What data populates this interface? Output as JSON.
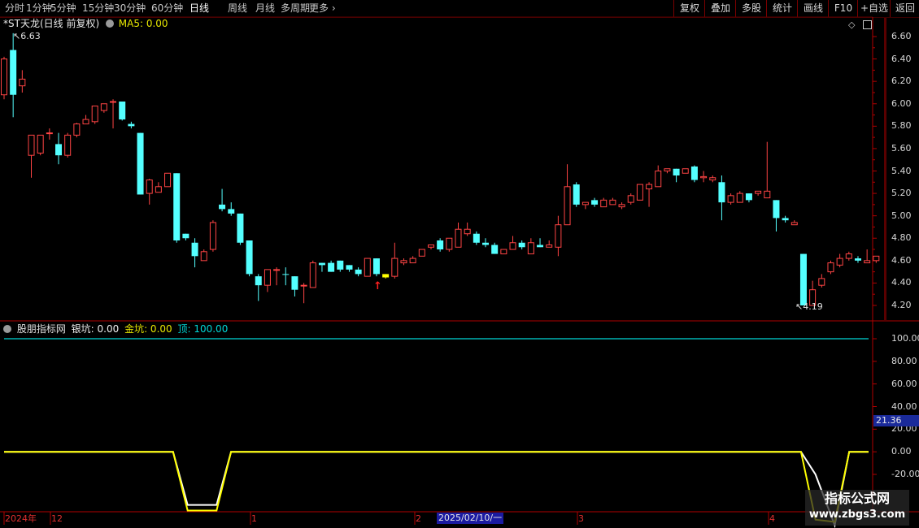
{
  "toolbar": {
    "periods": [
      "分时",
      "1分钟",
      "5分钟",
      "15分钟",
      "30分钟",
      "60分钟",
      "日线",
      "周线",
      "月线",
      "多周期",
      "更多"
    ],
    "active_period": "日线",
    "right_buttons": [
      "复权",
      "叠加",
      "多股",
      "统计",
      "画线",
      "F10",
      "+自选",
      "返回"
    ]
  },
  "main_panel": {
    "title": "*ST天龙(日线 前复权)",
    "indicator": "MA5: 0.00",
    "high_label": "6.63",
    "low_label": "4.19",
    "y_axis_labels": [
      "6.60",
      "6.40",
      "6.20",
      "6.00",
      "5.80",
      "5.60",
      "5.40",
      "5.20",
      "5.00",
      "4.80",
      "4.60",
      "4.40",
      "4.20"
    ]
  },
  "sub_panel": {
    "title": "股朋指标网",
    "silver_label": "银坑: 0.00",
    "gold_label": "金坑: 0.00",
    "top_label": "顶: 100.00",
    "y_axis_labels": [
      "100.00",
      "80.00",
      "60.00",
      "40.00",
      "20.00",
      "0.00",
      "-20.00"
    ],
    "cursor_value": "21.36"
  },
  "x_axis": {
    "labels": [
      "2024年",
      "12",
      "1",
      "2",
      "3",
      "4"
    ],
    "cursor_date": "2025/02/10/一"
  },
  "watermark": {
    "title": "指标公式网",
    "url": "www.zbgs3.com"
  },
  "colors": {
    "up": "#ff4444",
    "down": "#54ffff",
    "highlight": "#ffff00",
    "axis": "#b00000",
    "top_line": "#00d7d7",
    "gold_line": "#ffff00",
    "silver_line": "#ffffff"
  },
  "chart_data": [
    {
      "type": "candlestick",
      "title": "*ST天龙(日线 前复权)",
      "ylim": [
        4.15,
        6.7
      ],
      "columns": [
        "open",
        "close",
        "high",
        "low",
        "direction"
      ],
      "candles": [
        [
          6.4,
          6.08,
          6.42,
          6.04,
          "up"
        ],
        [
          6.48,
          6.08,
          6.63,
          5.88,
          "down"
        ],
        [
          6.16,
          6.22,
          6.3,
          6.1,
          "up"
        ],
        [
          5.54,
          5.72,
          5.72,
          5.34,
          "up"
        ],
        [
          5.56,
          5.72,
          5.72,
          5.54,
          "up"
        ],
        [
          5.74,
          5.74,
          5.78,
          5.68,
          "up"
        ],
        [
          5.64,
          5.54,
          5.74,
          5.46,
          "down"
        ],
        [
          5.72,
          5.54,
          5.74,
          5.52,
          "up"
        ],
        [
          5.72,
          5.82,
          5.83,
          5.7,
          "up"
        ],
        [
          5.86,
          5.82,
          5.9,
          5.82,
          "up"
        ],
        [
          5.84,
          5.98,
          5.98,
          5.82,
          "up"
        ],
        [
          5.94,
          6.0,
          6.0,
          5.92,
          "up"
        ],
        [
          6.02,
          6.02,
          6.04,
          5.78,
          "up"
        ],
        [
          6.02,
          5.86,
          6.02,
          5.85,
          "down"
        ],
        [
          5.82,
          5.8,
          5.84,
          5.78,
          "down"
        ],
        [
          5.74,
          5.19,
          5.74,
          5.19,
          "down"
        ],
        [
          5.2,
          5.32,
          5.33,
          5.1,
          "up"
        ],
        [
          5.21,
          5.26,
          5.3,
          5.21,
          "up"
        ],
        [
          5.38,
          5.26,
          5.38,
          5.26,
          "up"
        ],
        [
          5.38,
          4.78,
          5.38,
          4.76,
          "down"
        ],
        [
          4.84,
          4.8,
          4.84,
          4.78,
          "down"
        ],
        [
          4.76,
          4.64,
          4.8,
          4.54,
          "down"
        ],
        [
          4.6,
          4.68,
          4.7,
          4.6,
          "up"
        ],
        [
          4.7,
          4.94,
          4.96,
          4.68,
          "up"
        ],
        [
          5.1,
          5.06,
          5.24,
          5.04,
          "down"
        ],
        [
          5.06,
          5.02,
          5.12,
          5.0,
          "down"
        ],
        [
          5.02,
          4.76,
          5.02,
          4.74,
          "down"
        ],
        [
          4.78,
          4.48,
          4.78,
          4.46,
          "down"
        ],
        [
          4.46,
          4.38,
          4.48,
          4.24,
          "down"
        ],
        [
          4.38,
          4.52,
          4.52,
          4.32,
          "up"
        ],
        [
          4.52,
          4.52,
          4.54,
          4.38,
          "up"
        ],
        [
          4.48,
          4.48,
          4.54,
          4.38,
          "down"
        ],
        [
          4.46,
          4.34,
          4.46,
          4.28,
          "down"
        ],
        [
          4.38,
          4.38,
          4.4,
          4.22,
          "up"
        ],
        [
          4.36,
          4.58,
          4.6,
          4.36,
          "up"
        ],
        [
          4.58,
          4.56,
          4.58,
          4.5,
          "down"
        ],
        [
          4.58,
          4.5,
          4.6,
          4.5,
          "down"
        ],
        [
          4.6,
          4.52,
          4.6,
          4.5,
          "down"
        ],
        [
          4.56,
          4.52,
          4.56,
          4.5,
          "down"
        ],
        [
          4.52,
          4.48,
          4.54,
          4.46,
          "down"
        ],
        [
          4.46,
          4.62,
          4.62,
          4.46,
          "up"
        ],
        [
          4.62,
          4.48,
          4.62,
          4.46,
          "down"
        ],
        [
          4.48,
          4.45,
          4.48,
          4.44,
          "up"
        ],
        [
          4.46,
          4.62,
          4.76,
          4.44,
          "up"
        ],
        [
          4.58,
          4.6,
          4.62,
          4.56,
          "up"
        ],
        [
          4.58,
          4.62,
          4.64,
          4.58,
          "up"
        ],
        [
          4.64,
          4.7,
          4.7,
          4.64,
          "up"
        ],
        [
          4.72,
          4.74,
          4.74,
          4.7,
          "up"
        ],
        [
          4.78,
          4.7,
          4.8,
          4.68,
          "down"
        ],
        [
          4.7,
          4.8,
          4.8,
          4.68,
          "up"
        ],
        [
          4.72,
          4.88,
          4.94,
          4.72,
          "up"
        ],
        [
          4.88,
          4.84,
          4.94,
          4.82,
          "up"
        ],
        [
          4.84,
          4.76,
          4.86,
          4.74,
          "down"
        ],
        [
          4.76,
          4.74,
          4.8,
          4.72,
          "down"
        ],
        [
          4.74,
          4.66,
          4.76,
          4.66,
          "down"
        ],
        [
          4.66,
          4.7,
          4.7,
          4.66,
          "up"
        ],
        [
          4.7,
          4.76,
          4.82,
          4.7,
          "up"
        ],
        [
          4.76,
          4.72,
          4.78,
          4.7,
          "down"
        ],
        [
          4.66,
          4.76,
          4.8,
          4.66,
          "up"
        ],
        [
          4.74,
          4.72,
          4.8,
          4.72,
          "down"
        ],
        [
          4.72,
          4.74,
          4.78,
          4.72,
          "up"
        ],
        [
          4.72,
          4.92,
          5.0,
          4.64,
          "up"
        ],
        [
          4.92,
          5.26,
          5.46,
          4.92,
          "up"
        ],
        [
          5.28,
          5.1,
          5.3,
          5.08,
          "down"
        ],
        [
          5.1,
          5.12,
          5.12,
          5.06,
          "up"
        ],
        [
          5.14,
          5.1,
          5.16,
          5.08,
          "down"
        ],
        [
          5.08,
          5.14,
          5.16,
          5.08,
          "up"
        ],
        [
          5.14,
          5.1,
          5.16,
          5.1,
          "up"
        ],
        [
          5.08,
          5.1,
          5.12,
          5.06,
          "up"
        ],
        [
          5.12,
          5.18,
          5.2,
          5.1,
          "up"
        ],
        [
          5.14,
          5.28,
          5.28,
          5.14,
          "up"
        ],
        [
          5.28,
          5.24,
          5.3,
          5.08,
          "up"
        ],
        [
          5.26,
          5.4,
          5.45,
          5.26,
          "up"
        ],
        [
          5.4,
          5.42,
          5.42,
          5.38,
          "up"
        ],
        [
          5.42,
          5.36,
          5.42,
          5.3,
          "down"
        ],
        [
          5.38,
          5.42,
          5.42,
          5.38,
          "up"
        ],
        [
          5.44,
          5.32,
          5.45,
          5.3,
          "down"
        ],
        [
          5.34,
          5.35,
          5.4,
          5.3,
          "up"
        ],
        [
          5.32,
          5.34,
          5.36,
          5.3,
          "up"
        ],
        [
          5.3,
          5.12,
          5.36,
          4.96,
          "down"
        ],
        [
          5.12,
          5.18,
          5.2,
          5.1,
          "up"
        ],
        [
          5.12,
          5.2,
          5.22,
          5.12,
          "up"
        ],
        [
          5.2,
          5.14,
          5.2,
          5.12,
          "down"
        ],
        [
          5.22,
          5.2,
          5.22,
          5.18,
          "up"
        ],
        [
          5.16,
          5.22,
          5.66,
          5.16,
          "up"
        ],
        [
          5.14,
          4.98,
          5.14,
          4.86,
          "down"
        ],
        [
          4.98,
          4.96,
          5.0,
          4.94,
          "down"
        ],
        [
          4.94,
          4.92,
          4.96,
          4.92,
          "up"
        ],
        [
          4.66,
          4.2,
          4.66,
          4.2,
          "down"
        ],
        [
          4.2,
          4.34,
          4.42,
          4.2,
          "up"
        ],
        [
          4.38,
          4.44,
          4.48,
          4.36,
          "up"
        ],
        [
          4.5,
          4.58,
          4.6,
          4.48,
          "up"
        ],
        [
          4.56,
          4.62,
          4.66,
          4.54,
          "up"
        ],
        [
          4.62,
          4.66,
          4.68,
          4.6,
          "up"
        ],
        [
          4.6,
          4.62,
          4.64,
          4.58,
          "down"
        ],
        [
          4.58,
          4.6,
          4.7,
          4.58,
          "up"
        ],
        [
          4.6,
          4.64,
          4.64,
          4.58,
          "up"
        ]
      ],
      "highlighted_candle": 42
    },
    {
      "type": "line",
      "title": "股朋指标网",
      "ylim": [
        -25,
        105
      ],
      "series": [
        {
          "name": "顶",
          "values": [
            100,
            100
          ]
        },
        {
          "name": "金坑",
          "x": [
            0,
            35,
            38,
            44,
            47,
            165,
            168,
            172,
            175,
            179
          ],
          "values": [
            0,
            0,
            -52,
            -52,
            0,
            0,
            -60,
            -62,
            0,
            0
          ]
        },
        {
          "name": "银坑",
          "x": [
            0,
            35,
            38,
            44,
            47,
            165,
            168,
            172,
            175,
            179
          ],
          "values": [
            0,
            0,
            -47,
            -47,
            0,
            0,
            -20,
            -65,
            0,
            0
          ]
        }
      ]
    }
  ]
}
